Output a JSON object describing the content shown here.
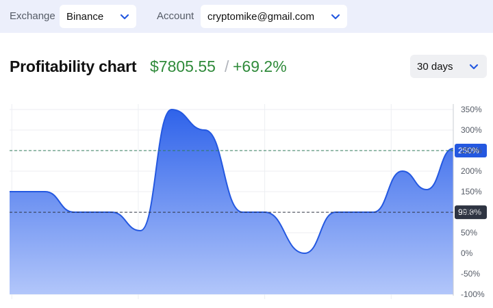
{
  "toolbar": {
    "exchange_label": "Exchange",
    "exchange_value": "Binance",
    "account_label": "Account",
    "account_value": "cryptomike@gmail.com"
  },
  "header": {
    "title": "Profitability chart",
    "amount": "$7805.55",
    "separator": "/",
    "percent": "+69.2%",
    "period_value": "30 days"
  },
  "colors": {
    "accent": "#2458e0",
    "positive": "#2f8a3a",
    "dark_badge": "#2e3442"
  },
  "icons": {
    "dropdown": "chevron-down-icon"
  },
  "chart_data": {
    "type": "area",
    "ylim": [
      -100,
      350
    ],
    "yticks": [
      "350%",
      "300%",
      "250%",
      "200%",
      "150%",
      "100%",
      "50%",
      "0%",
      "-50%",
      "-100%"
    ],
    "ytick_values": [
      350,
      300,
      250,
      200,
      150,
      100,
      50,
      0,
      -50,
      -100
    ],
    "points": [
      {
        "x": 0,
        "y": 150
      },
      {
        "x": 0.08,
        "y": 150
      },
      {
        "x": 0.145,
        "y": 100
      },
      {
        "x": 0.23,
        "y": 100
      },
      {
        "x": 0.295,
        "y": 55
      },
      {
        "x": 0.365,
        "y": 350
      },
      {
        "x": 0.44,
        "y": 300
      },
      {
        "x": 0.525,
        "y": 100
      },
      {
        "x": 0.575,
        "y": 100
      },
      {
        "x": 0.665,
        "y": 0
      },
      {
        "x": 0.735,
        "y": 100
      },
      {
        "x": 0.82,
        "y": 100
      },
      {
        "x": 0.885,
        "y": 200
      },
      {
        "x": 0.94,
        "y": 155
      },
      {
        "x": 1.0,
        "y": 255
      }
    ],
    "reference_lines": [
      {
        "value": 250,
        "label": "250%",
        "style": "dashed-green",
        "badge": "blue"
      },
      {
        "value": 99.8,
        "label": "99.8%",
        "style": "dashed-dark",
        "badge": "dark"
      }
    ]
  }
}
